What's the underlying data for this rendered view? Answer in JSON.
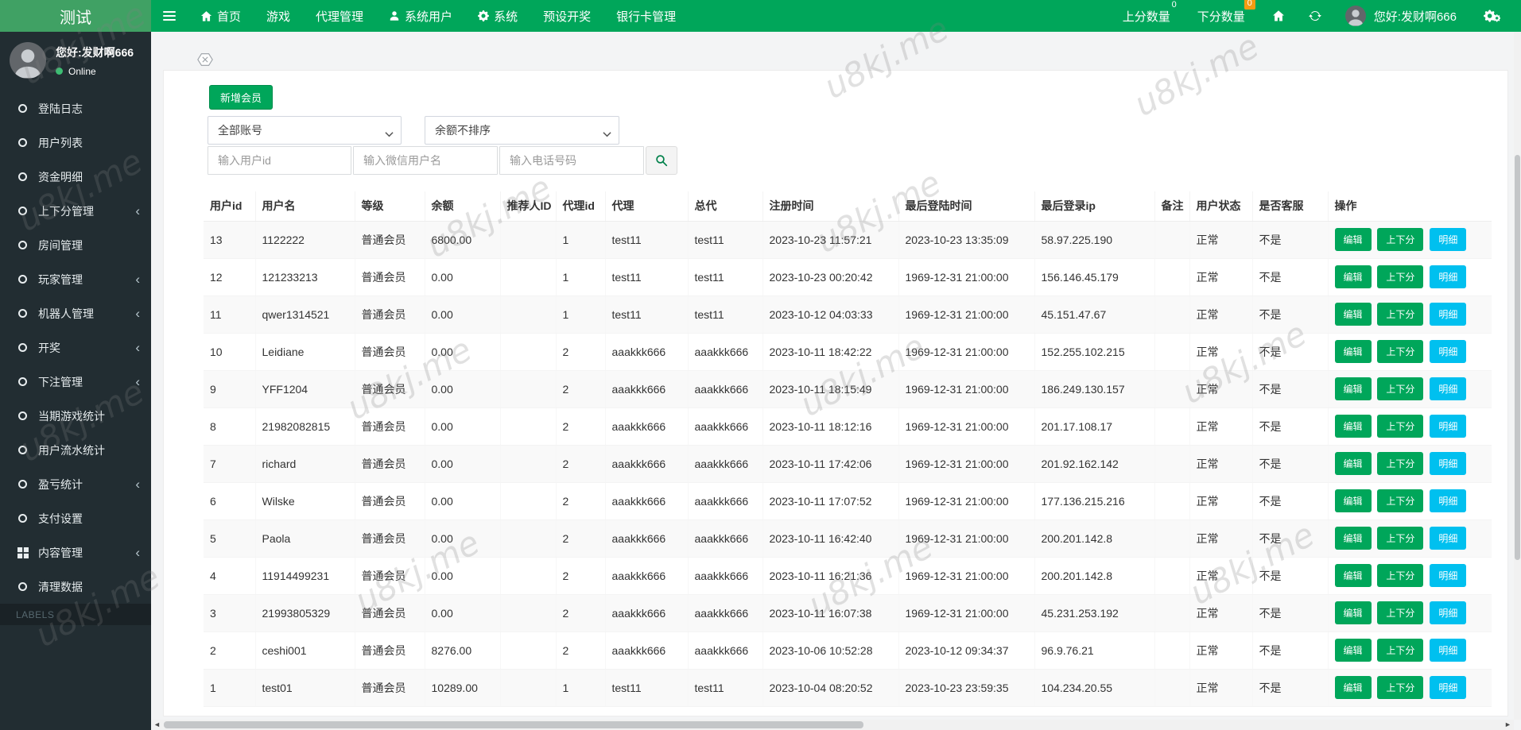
{
  "app": {
    "brand": "测试",
    "watermark": "u8kj.me"
  },
  "navbar": {
    "menu": [
      {
        "label": "首页",
        "icon": "home-icon"
      },
      {
        "label": "游戏",
        "icon": null
      },
      {
        "label": "代理管理",
        "icon": null
      },
      {
        "label": "系统用户",
        "icon": "user-icon"
      },
      {
        "label": "系统",
        "icon": "gear-icon"
      },
      {
        "label": "预设开奖",
        "icon": null
      },
      {
        "label": "银行卡管理",
        "icon": null
      }
    ],
    "up_score": {
      "label": "上分数量",
      "count": "0"
    },
    "down_score": {
      "label": "下分数量",
      "count": "0"
    },
    "greeting": "您好:发财啊666"
  },
  "sidebar": {
    "greeting": "您好:发财啊666",
    "status": "Online",
    "items": [
      {
        "label": "登陆日志",
        "icon": "circle",
        "chevron": false
      },
      {
        "label": "用户列表",
        "icon": "circle",
        "chevron": false
      },
      {
        "label": "资金明细",
        "icon": "circle",
        "chevron": false
      },
      {
        "label": "上下分管理",
        "icon": "circle",
        "chevron": true
      },
      {
        "label": "房间管理",
        "icon": "circle",
        "chevron": false
      },
      {
        "label": "玩家管理",
        "icon": "circle",
        "chevron": true
      },
      {
        "label": "机器人管理",
        "icon": "circle",
        "chevron": true
      },
      {
        "label": "开奖",
        "icon": "circle",
        "chevron": true
      },
      {
        "label": "下注管理",
        "icon": "circle",
        "chevron": true
      },
      {
        "label": "当期游戏统计",
        "icon": "circle",
        "chevron": false
      },
      {
        "label": "用户流水统计",
        "icon": "circle",
        "chevron": false
      },
      {
        "label": "盈亏统计",
        "icon": "circle",
        "chevron": true
      },
      {
        "label": "支付设置",
        "icon": "circle",
        "chevron": false
      },
      {
        "label": "内容管理",
        "icon": "grid",
        "chevron": true
      },
      {
        "label": "清理数据",
        "icon": "circle",
        "chevron": false
      }
    ],
    "section_label": "LABELS"
  },
  "toolbar": {
    "add_member_label": "新增会员",
    "account_filter_value": "全部账号",
    "balance_sort_value": "余额不排序",
    "user_id_placeholder": "输入用户id",
    "wechat_placeholder": "输入微信用户名",
    "phone_placeholder": "输入电话号码"
  },
  "table": {
    "headers": [
      "用户id",
      "用户名",
      "等级",
      "余额",
      "推荐人ID",
      "代理id",
      "代理",
      "总代",
      "注册时间",
      "最后登陆时间",
      "最后登录ip",
      "备注",
      "用户状态",
      "是否客服",
      "操作"
    ],
    "action_labels": {
      "edit": "编辑",
      "updown": "上下分",
      "detail": "明细"
    },
    "rows": [
      {
        "id": "13",
        "name": "1122222",
        "level": "普通会员",
        "balance": "6800.00",
        "referrer": "",
        "agent_id": "1",
        "agent": "test11",
        "general": "test11",
        "reg_time": "2023-10-23 11:57:21",
        "last_login": "2023-10-23 13:35:09",
        "last_ip": "58.97.225.190",
        "remark": "",
        "status": "正常",
        "is_cs": "不是"
      },
      {
        "id": "12",
        "name": "121233213",
        "level": "普通会员",
        "balance": "0.00",
        "referrer": "",
        "agent_id": "1",
        "agent": "test11",
        "general": "test11",
        "reg_time": "2023-10-23 00:20:42",
        "last_login": "1969-12-31 21:00:00",
        "last_ip": "156.146.45.179",
        "remark": "",
        "status": "正常",
        "is_cs": "不是"
      },
      {
        "id": "11",
        "name": "qwer1314521",
        "level": "普通会员",
        "balance": "0.00",
        "referrer": "",
        "agent_id": "1",
        "agent": "test11",
        "general": "test11",
        "reg_time": "2023-10-12 04:03:33",
        "last_login": "1969-12-31 21:00:00",
        "last_ip": "45.151.47.67",
        "remark": "",
        "status": "正常",
        "is_cs": "不是"
      },
      {
        "id": "10",
        "name": "Leidiane",
        "level": "普通会员",
        "balance": "0.00",
        "referrer": "",
        "agent_id": "2",
        "agent": "aaakkk666",
        "general": "aaakkk666",
        "reg_time": "2023-10-11 18:42:22",
        "last_login": "1969-12-31 21:00:00",
        "last_ip": "152.255.102.215",
        "remark": "",
        "status": "正常",
        "is_cs": "不是"
      },
      {
        "id": "9",
        "name": "YFF1204",
        "level": "普通会员",
        "balance": "0.00",
        "referrer": "",
        "agent_id": "2",
        "agent": "aaakkk666",
        "general": "aaakkk666",
        "reg_time": "2023-10-11 18:15:49",
        "last_login": "1969-12-31 21:00:00",
        "last_ip": "186.249.130.157",
        "remark": "",
        "status": "正常",
        "is_cs": "不是"
      },
      {
        "id": "8",
        "name": "21982082815",
        "level": "普通会员",
        "balance": "0.00",
        "referrer": "",
        "agent_id": "2",
        "agent": "aaakkk666",
        "general": "aaakkk666",
        "reg_time": "2023-10-11 18:12:16",
        "last_login": "1969-12-31 21:00:00",
        "last_ip": "201.17.108.17",
        "remark": "",
        "status": "正常",
        "is_cs": "不是"
      },
      {
        "id": "7",
        "name": "richard",
        "level": "普通会员",
        "balance": "0.00",
        "referrer": "",
        "agent_id": "2",
        "agent": "aaakkk666",
        "general": "aaakkk666",
        "reg_time": "2023-10-11 17:42:06",
        "last_login": "1969-12-31 21:00:00",
        "last_ip": "201.92.162.142",
        "remark": "",
        "status": "正常",
        "is_cs": "不是"
      },
      {
        "id": "6",
        "name": "Wilske",
        "level": "普通会员",
        "balance": "0.00",
        "referrer": "",
        "agent_id": "2",
        "agent": "aaakkk666",
        "general": "aaakkk666",
        "reg_time": "2023-10-11 17:07:52",
        "last_login": "1969-12-31 21:00:00",
        "last_ip": "177.136.215.216",
        "remark": "",
        "status": "正常",
        "is_cs": "不是"
      },
      {
        "id": "5",
        "name": "Paola",
        "level": "普通会员",
        "balance": "0.00",
        "referrer": "",
        "agent_id": "2",
        "agent": "aaakkk666",
        "general": "aaakkk666",
        "reg_time": "2023-10-11 16:42:40",
        "last_login": "1969-12-31 21:00:00",
        "last_ip": "200.201.142.8",
        "remark": "",
        "status": "正常",
        "is_cs": "不是"
      },
      {
        "id": "4",
        "name": "11914499231",
        "level": "普通会员",
        "balance": "0.00",
        "referrer": "",
        "agent_id": "2",
        "agent": "aaakkk666",
        "general": "aaakkk666",
        "reg_time": "2023-10-11 16:21:36",
        "last_login": "1969-12-31 21:00:00",
        "last_ip": "200.201.142.8",
        "remark": "",
        "status": "正常",
        "is_cs": "不是"
      },
      {
        "id": "3",
        "name": "21993805329",
        "level": "普通会员",
        "balance": "0.00",
        "referrer": "",
        "agent_id": "2",
        "agent": "aaakkk666",
        "general": "aaakkk666",
        "reg_time": "2023-10-11 16:07:38",
        "last_login": "1969-12-31 21:00:00",
        "last_ip": "45.231.253.192",
        "remark": "",
        "status": "正常",
        "is_cs": "不是"
      },
      {
        "id": "2",
        "name": "ceshi001",
        "level": "普通会员",
        "balance": "8276.00",
        "referrer": "",
        "agent_id": "2",
        "agent": "aaakkk666",
        "general": "aaakkk666",
        "reg_time": "2023-10-06 10:52:28",
        "last_login": "2023-10-12 09:34:37",
        "last_ip": "96.9.76.21",
        "remark": "",
        "status": "正常",
        "is_cs": "不是"
      },
      {
        "id": "1",
        "name": "test01",
        "level": "普通会员",
        "balance": "10289.00",
        "referrer": "",
        "agent_id": "1",
        "agent": "test11",
        "general": "test11",
        "reg_time": "2023-10-04 08:20:52",
        "last_login": "2023-10-23 23:59:35",
        "last_ip": "104.234.20.55",
        "remark": "",
        "status": "正常",
        "is_cs": "不是"
      }
    ]
  },
  "colors": {
    "green": "#00a65a",
    "cyan": "#00c0ef",
    "orange": "#f39c12",
    "sidebar_bg": "#222d32"
  }
}
